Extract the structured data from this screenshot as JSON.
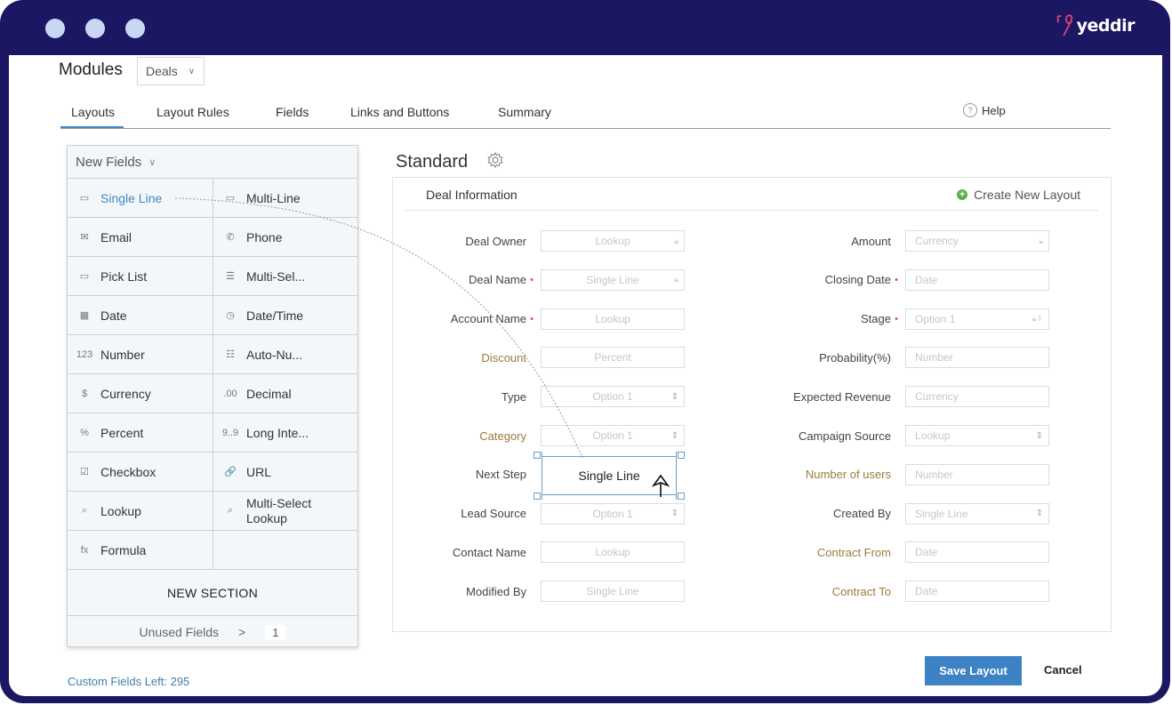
{
  "window": {
    "brand": "yeddir",
    "brand_color": "#e0407a",
    "frame_color": "#1c1763"
  },
  "header": {
    "modules_label": "Modules",
    "module_select_value": "Deals",
    "tabs": [
      {
        "label": "Layouts",
        "active": true
      },
      {
        "label": "Layout Rules",
        "active": false
      },
      {
        "label": "Fields",
        "active": false
      },
      {
        "label": "Links and Buttons",
        "active": false
      },
      {
        "label": "Summary",
        "active": false
      }
    ],
    "help_label": "Help"
  },
  "palette": {
    "title": "New Fields",
    "items": [
      {
        "label": "Single Line",
        "icon": "single-line-icon",
        "glyph": "▭",
        "selected": true
      },
      {
        "label": "Multi-Line",
        "icon": "multi-line-icon",
        "glyph": "▭"
      },
      {
        "label": "Email",
        "icon": "email-icon",
        "glyph": "✉"
      },
      {
        "label": "Phone",
        "icon": "phone-icon",
        "glyph": "✆"
      },
      {
        "label": "Pick List",
        "icon": "pick-list-icon",
        "glyph": "▭"
      },
      {
        "label": "Multi-Sel...",
        "icon": "multi-select-icon",
        "glyph": "☰"
      },
      {
        "label": "Date",
        "icon": "calendar-icon",
        "glyph": "▦"
      },
      {
        "label": "Date/Time",
        "icon": "date-time-icon",
        "glyph": "◷"
      },
      {
        "label": "Number",
        "icon": "number-icon",
        "glyph": "123"
      },
      {
        "label": "Auto-Nu...",
        "icon": "auto-number-icon",
        "glyph": "☷"
      },
      {
        "label": "Currency",
        "icon": "currency-icon",
        "glyph": "$"
      },
      {
        "label": "Decimal",
        "icon": "decimal-icon",
        "glyph": ".00"
      },
      {
        "label": "Percent",
        "icon": "percent-icon",
        "glyph": "%"
      },
      {
        "label": "Long Inte...",
        "icon": "long-integer-icon",
        "glyph": "9..9"
      },
      {
        "label": "Checkbox",
        "icon": "checkbox-icon",
        "glyph": "☑"
      },
      {
        "label": "URL",
        "icon": "link-icon",
        "glyph": "🔗"
      },
      {
        "label": "Lookup",
        "icon": "lookup-icon",
        "glyph": "⌕"
      },
      {
        "label": "Multi-Select Lookup",
        "icon": "multi-select-lookup-icon",
        "glyph": "⌕"
      },
      {
        "label": "Formula",
        "icon": "formula-icon",
        "glyph": "fx"
      },
      {
        "label": "",
        "icon": "",
        "glyph": ""
      }
    ],
    "new_section_label": "NEW SECTION",
    "unused_fields_label": "Unused Fields",
    "unused_fields_arrow": ">",
    "unused_fields_count": "1",
    "custom_fields_left": "Custom Fields Left: 295"
  },
  "layout": {
    "title": "Standard",
    "section_title": "Deal Information",
    "create_new_layout_label": "Create New Layout",
    "left_fields": [
      {
        "label": "Deal Owner",
        "placeholder": "Lookup",
        "required": false,
        "custom": false,
        "trail": "lock"
      },
      {
        "label": "Deal Name",
        "placeholder": "Single Line",
        "required": true,
        "custom": false,
        "trail": "lock"
      },
      {
        "label": "Account Name",
        "placeholder": "Lookup",
        "required": true,
        "custom": false,
        "trail": ""
      },
      {
        "label": "Discount",
        "placeholder": "Percent",
        "required": false,
        "custom": true,
        "trail": ""
      },
      {
        "label": "Type",
        "placeholder": "Option 1",
        "required": false,
        "custom": false,
        "trail": "updown"
      },
      {
        "label": "Category",
        "placeholder": "Option 1",
        "required": false,
        "custom": true,
        "trail": "updown"
      },
      {
        "label": "Next Step",
        "placeholder": "",
        "required": false,
        "custom": false,
        "trail": ""
      },
      {
        "label": "Lead Source",
        "placeholder": "Option 1",
        "required": false,
        "custom": false,
        "trail": "updown"
      },
      {
        "label": "Contact Name",
        "placeholder": "Lookup",
        "required": false,
        "custom": false,
        "trail": ""
      },
      {
        "label": "Modified By",
        "placeholder": "Single Line",
        "required": false,
        "custom": false,
        "trail": ""
      }
    ],
    "right_fields": [
      {
        "label": "Amount",
        "placeholder": "Currency",
        "required": false,
        "custom": false,
        "trail": "lock"
      },
      {
        "label": "Closing Date",
        "placeholder": "Date",
        "required": true,
        "custom": false,
        "trail": ""
      },
      {
        "label": "Stage",
        "placeholder": "Option 1",
        "required": true,
        "custom": false,
        "trail": "lock-updown"
      },
      {
        "label": "Probability(%)",
        "placeholder": "Number",
        "required": false,
        "custom": false,
        "trail": ""
      },
      {
        "label": "Expected Revenue",
        "placeholder": "Currency",
        "required": false,
        "custom": false,
        "trail": ""
      },
      {
        "label": "Campaign Source",
        "placeholder": "Lookup",
        "required": false,
        "custom": false,
        "trail": "updown"
      },
      {
        "label": "Number of users",
        "placeholder": "Number",
        "required": false,
        "custom": true,
        "trail": ""
      },
      {
        "label": "Created By",
        "placeholder": "Single Line",
        "required": false,
        "custom": false,
        "trail": "updown"
      },
      {
        "label": "Contract From",
        "placeholder": "Date",
        "required": false,
        "custom": true,
        "trail": ""
      },
      {
        "label": "Contract To",
        "placeholder": "Date",
        "required": false,
        "custom": true,
        "trail": ""
      }
    ],
    "drop_target_label": "Single Line"
  },
  "footer": {
    "save_label": "Save Layout",
    "cancel_label": "Cancel"
  }
}
